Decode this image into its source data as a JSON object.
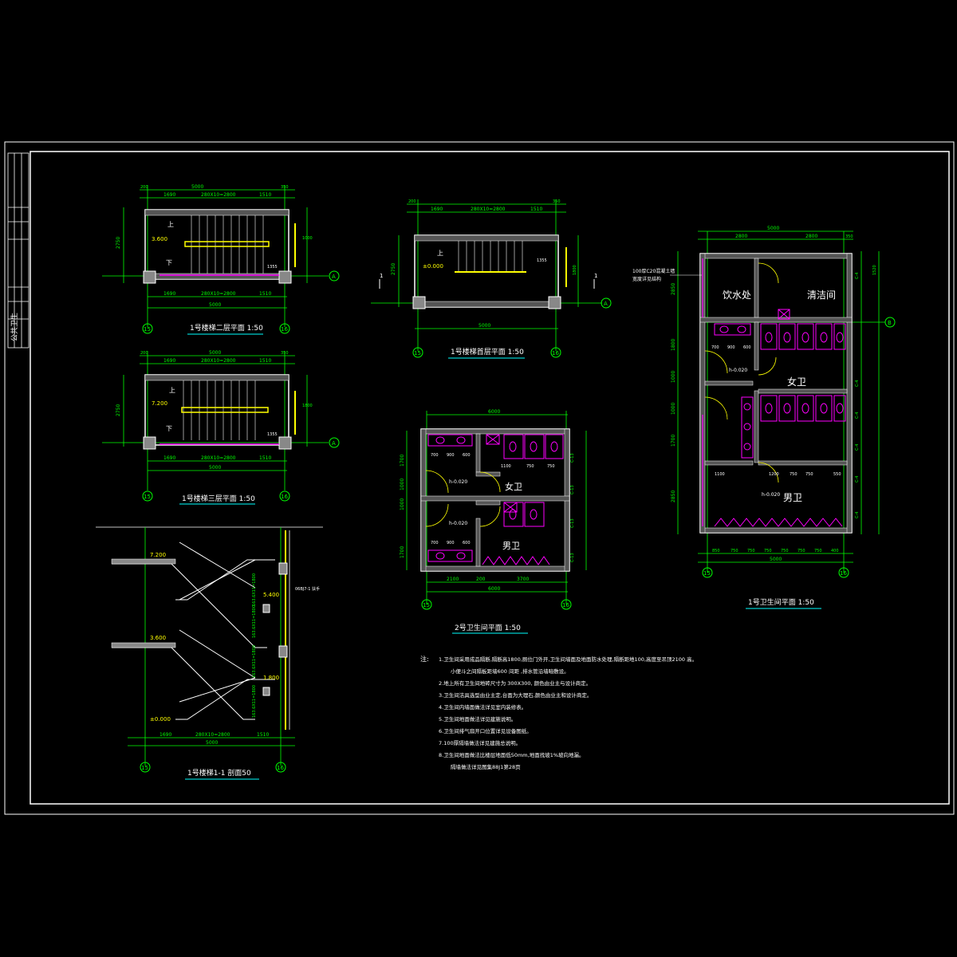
{
  "sheet": {
    "title_block_side_text": "公共卫生",
    "colors": {
      "background": "#000000",
      "frame": "#ffffff",
      "dimension": "#00ff00",
      "wall": "#ffffff",
      "hatch": "#808080",
      "stair": "#ffff00",
      "fixture": "#ff00ff",
      "axis": "#00ff00",
      "text": "#ffffff",
      "level": "#00ff00"
    }
  },
  "stair_plan_2": {
    "caption": "1号楼梯二层平面  1:50",
    "dims_top": [
      "200",
      "100",
      "5000",
      "1690",
      "280X10=2800",
      "1510",
      "350"
    ],
    "dims_bottom": [
      "1690",
      "280X10=2800",
      "1510",
      "5000"
    ],
    "dims_left": [
      "2750",
      "150",
      "150"
    ],
    "dims_right": [
      "150",
      "1200",
      "240",
      "1000",
      "1355",
      "600"
    ],
    "up_label": "上",
    "down_label": "下",
    "level": "3.600",
    "axis_labels": [
      "15",
      "16"
    ],
    "axis_right": "A"
  },
  "stair_plan_1": {
    "caption": "1号楼梯首层平面  1:50",
    "dims_top": [
      "200",
      "100",
      "1690",
      "280X10=2800",
      "1510",
      "350"
    ],
    "dims_bottom": [
      "5000"
    ],
    "dims_left": [
      "2750",
      "150"
    ],
    "dims_right": [
      "150",
      "1200",
      "1355",
      "1800",
      "600"
    ],
    "up_label": "上",
    "level": "±0.000",
    "section_mark": "1",
    "axis_labels": [
      "15",
      "16"
    ],
    "axis_right": "A"
  },
  "stair_plan_3": {
    "caption": "1号楼梯三层平面  1:50",
    "dims_top": [
      "200",
      "100",
      "5000",
      "1690",
      "280X10=2800",
      "1510",
      "350"
    ],
    "dims_bottom": [
      "1690",
      "280X10=2800",
      "1510",
      "5000"
    ],
    "dims_left": [
      "2750",
      "150",
      "150"
    ],
    "dims_right": [
      "150",
      "1200",
      "240",
      "1800",
      "1355",
      "600"
    ],
    "up_label": "上",
    "down_label": "下",
    "level": "7.200",
    "axis_labels": [
      "15",
      "16"
    ],
    "axis_right": "A"
  },
  "stair_section": {
    "caption": "1号楼梯1-1   剖面50",
    "levels": [
      "7.200",
      "5.400",
      "3.600",
      "1.800",
      "±0.000"
    ],
    "dims_bottom": [
      "1690",
      "280X10=2800",
      "1510",
      "5000"
    ],
    "flight_labels": [
      "163.6X11=1800",
      "163.6X11=1800",
      "163.6X11=1800",
      "163.6X11=1800"
    ],
    "note_right": "06BJ7-1 扶手",
    "axis_labels": [
      "15",
      "16"
    ]
  },
  "toilet_plan_2": {
    "caption": "2号卫生间平面  1:50",
    "dims_top": [
      "6000"
    ],
    "dims_bottom": [
      "2100",
      "200",
      "3700",
      "6000"
    ],
    "dims_row_a": [
      "600",
      "700",
      "600",
      "900",
      "600",
      "400",
      "750",
      "750"
    ],
    "dims_row_b": [
      "400",
      "1100",
      "750",
      "750",
      "550"
    ],
    "dims_left": [
      "1700",
      "1000",
      "100",
      "1000",
      "1700"
    ],
    "dims_right": [
      "C-13",
      "C-13",
      "C-13",
      "C-13",
      "C-13",
      "C-13"
    ],
    "room_female": "女卫",
    "room_male": "男卫",
    "level_1": "h-0.020",
    "level_2": "h-0.020",
    "axis_labels": [
      "15",
      "16"
    ]
  },
  "toilet_plan_1": {
    "caption": "1号卫生间平面   1:50",
    "dims_top": [
      "5000",
      "2800",
      "2800",
      "350"
    ],
    "dims_bottom": [
      "850",
      "750",
      "750",
      "750",
      "750",
      "750",
      "750",
      "400",
      "5000"
    ],
    "dims_row_a": [
      "700",
      "900",
      "600"
    ],
    "dims_row_b": [
      "1100",
      "1200",
      "450",
      "750",
      "750",
      "550"
    ],
    "dims_left": [
      "200",
      "2850",
      "1800",
      "1000",
      "100",
      "1000",
      "1700",
      "200",
      "2850",
      "200"
    ],
    "dims_right": [
      "1520",
      "C-4",
      "C-4",
      "C-4",
      "C-4",
      "C-4",
      "C-4",
      "C-4"
    ],
    "note_topleft_1": "100厚C20混凝土墙",
    "note_topleft_2": "宽度详见结构",
    "room_drinking": "饮水处",
    "room_cleaning": "清洁间",
    "room_female": "女卫",
    "room_male": "男卫",
    "level_1": "h-0.020",
    "level_2": "h-0.020",
    "axis_labels": [
      "15",
      "16"
    ],
    "axis_right": "B"
  },
  "notes": {
    "heading": "注:",
    "items": [
      "1.卫生间采用成品隔断,隔断高1800,厕位门外开,卫生间墙面及地面防水处理,隔断距地100,高度至吊顶2100          高。",
      "小便斗之间隔板距墙600     间距      ,排水管沿墙暗敷设。",
      "2.地上所有卫生间地砖尺寸为 300X300, 颜色由业主与设计商定。",
      "3.卫生间洁具选型由业主定,台面为大理石,颜色由业主和设计商定。",
      "4.卫生间内墙面做法详见室内装修表。",
      "5.卫生间地面做法详见建施说明。",
      "6.卫生间排气扇开口位置详见设备图纸。",
      "7.100厚隔墙做法详见建施总说明。",
      "8.卫生间地面做法比楼层地面低50mm,地面找坡1%坡向地漏。",
      "隔墙做法详见图集88J1第28页"
    ]
  }
}
